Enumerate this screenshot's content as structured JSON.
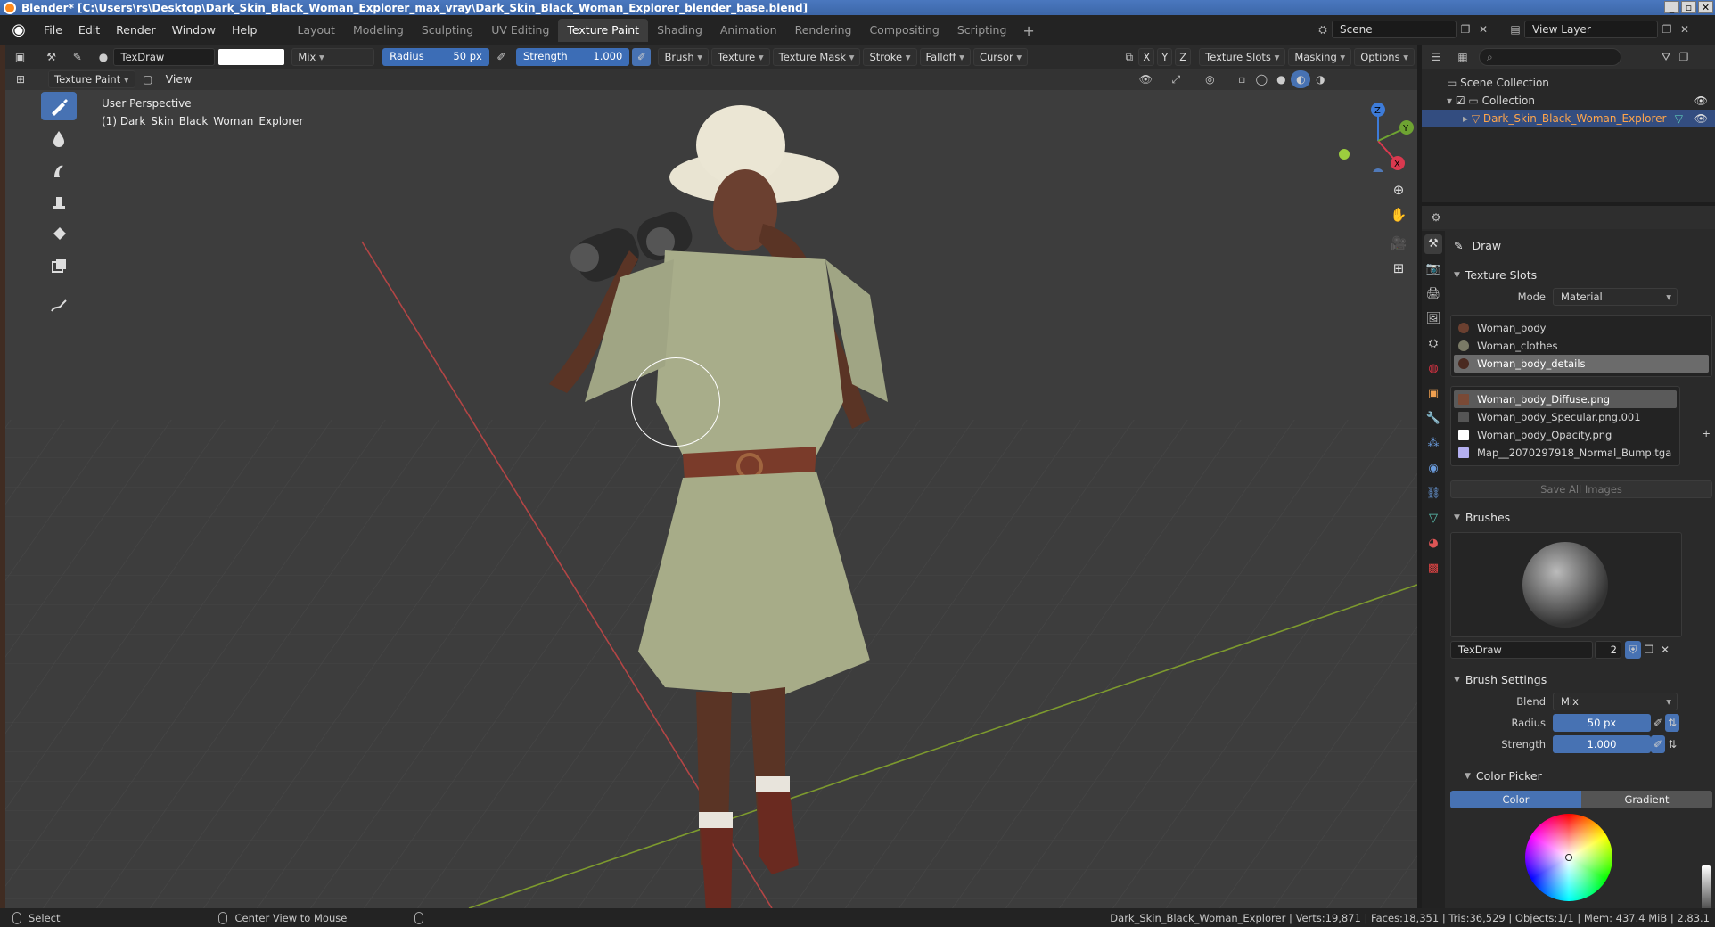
{
  "window": {
    "title": "Blender* [C:\\Users\\rs\\Desktop\\Dark_Skin_Black_Woman_Explorer_max_vray\\Dark_Skin_Black_Woman_Explorer_blender_base.blend]",
    "controls": [
      "_",
      "▫",
      "✕"
    ]
  },
  "menu": [
    "File",
    "Edit",
    "Render",
    "Window",
    "Help"
  ],
  "workspaces": [
    {
      "label": "Layout",
      "active": false
    },
    {
      "label": "Modeling",
      "active": false
    },
    {
      "label": "Sculpting",
      "active": false
    },
    {
      "label": "UV Editing",
      "active": false
    },
    {
      "label": "Texture Paint",
      "active": true
    },
    {
      "label": "Shading",
      "active": false
    },
    {
      "label": "Animation",
      "active": false
    },
    {
      "label": "Rendering",
      "active": false
    },
    {
      "label": "Compositing",
      "active": false
    },
    {
      "label": "Scripting",
      "active": false
    }
  ],
  "scene": {
    "name": "Scene",
    "view_layer": "View Layer"
  },
  "tool_header": {
    "brush_name": "TexDraw",
    "blend": "Mix",
    "radius_label": "Radius",
    "radius_value": "50 px",
    "strength_label": "Strength",
    "strength_value": "1.000",
    "brush": "Brush",
    "texture": "Texture",
    "texture_mask": "Texture Mask",
    "stroke": "Stroke",
    "falloff": "Falloff",
    "cursor": "Cursor",
    "axes": [
      "X",
      "Y",
      "Z"
    ],
    "texture_slots": "Texture Slots",
    "masking": "Masking",
    "options": "Options"
  },
  "mode_header": {
    "mode": "Texture Paint",
    "view": "View"
  },
  "viewport": {
    "perspective": "User Perspective",
    "object": "(1) Dark_Skin_Black_Woman_Explorer",
    "gizmo": {
      "x": "X",
      "y": "Y",
      "z": "Z"
    }
  },
  "outliner": {
    "root": "Scene Collection",
    "collection": "Collection",
    "object": "Dark_Skin_Black_Woman_Explorer"
  },
  "properties": {
    "tool_name": "Draw",
    "texture_slots": {
      "title": "Texture Slots",
      "mode_label": "Mode",
      "mode_value": "Material",
      "materials": [
        "Woman_body",
        "Woman_clothes",
        "Woman_body_details"
      ],
      "selected_material": 2,
      "images": [
        "Woman_body_Diffuse.png",
        "Woman_body_Specular.png.001",
        "Woman_body_Opacity.png",
        "Map__2070297918_Normal_Bump.tga"
      ],
      "selected_image": 0,
      "save_all": "Save All Images"
    },
    "brushes": {
      "title": "Brushes",
      "name": "TexDraw",
      "users": "2"
    },
    "brush_settings": {
      "title": "Brush Settings",
      "blend_label": "Blend",
      "blend_value": "Mix",
      "radius_label": "Radius",
      "radius_value": "50 px",
      "strength_label": "Strength",
      "strength_value": "1.000"
    },
    "color_picker": {
      "title": "Color Picker",
      "tab_color": "Color",
      "tab_gradient": "Gradient"
    }
  },
  "status": {
    "select": "Select",
    "center_view": "Center View to Mouse",
    "stats": "Dark_Skin_Black_Woman_Explorer | Verts:19,871 | Faces:18,351 | Tris:36,529 | Objects:1/1 | Mem: 437.4 MiB | 2.83.1"
  },
  "colors": {
    "accent": "#4772b3",
    "selection": "#334d80",
    "viewport_bg": "#3d3d3d"
  }
}
